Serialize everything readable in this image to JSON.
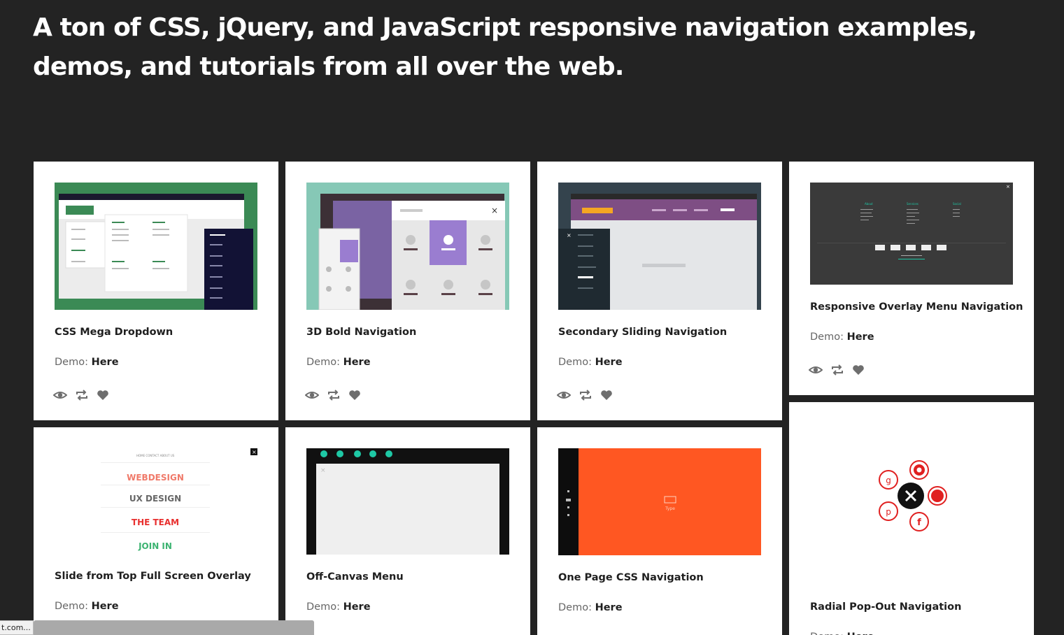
{
  "headline": "A ton of CSS, jQuery, and JavaScript responsive navigation examples, demos, and tutorials from all over the web.",
  "demo_prefix": "Demo:",
  "demo_link": "Here",
  "status_url": "t.com...",
  "cards": [
    {
      "title": "CSS Mega Dropdown"
    },
    {
      "title": "3D Bold Navigation"
    },
    {
      "title": "Secondary Sliding Navigation"
    },
    {
      "title": "Responsive Overlay Menu Navigation"
    },
    {
      "title": "Slide from Top Full Screen Overlay"
    },
    {
      "title": "Off-Canvas Menu"
    },
    {
      "title": "One Page CSS Navigation"
    },
    {
      "title": "Radial Pop-Out Navigation"
    }
  ],
  "thumbs": {
    "overlay": {
      "col1": "About",
      "col2": "Services",
      "col3": "Social"
    },
    "slide_top": {
      "nav": "HOME   CONTACT   ABOUT US",
      "items": [
        "WEBDESIGN",
        "UX DESIGN",
        "THE TEAM",
        "JOIN IN"
      ]
    },
    "one_page": {
      "label": "Type"
    }
  },
  "colors": {
    "background": "#232323",
    "green": "#3b8a55",
    "purple": "#7e4e84",
    "orange": "#ff5722",
    "red": "#e02020",
    "teal": "#1ec8a5"
  }
}
